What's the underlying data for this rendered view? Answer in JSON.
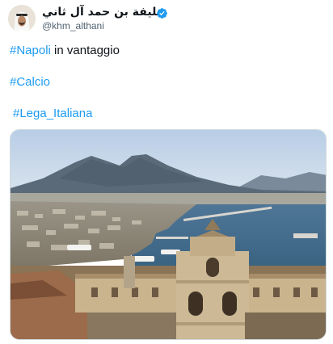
{
  "author": {
    "display_name": "خليفة بن حمد آل ثاني",
    "handle": "@khm_althani",
    "verified_color": "#1d9bf0",
    "avatar_icon": "person-avatar-icon"
  },
  "tweet": {
    "line1_hashtag": "#Napoli",
    "line1_text": " in vantaggio",
    "line2_hashtag": "#Calcio",
    "line3_hashtag": "#Lega_Italiana",
    "hashtag_color": "#1d9bf0"
  },
  "media": {
    "alt": "Panorama of Naples with Mount Vesuvius and the harbor"
  }
}
